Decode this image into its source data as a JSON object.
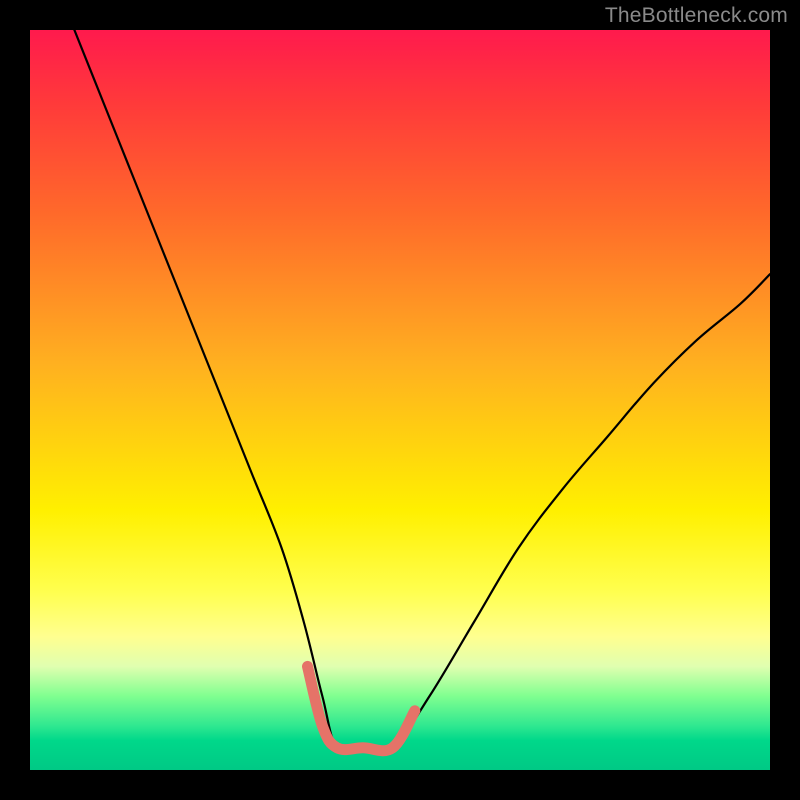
{
  "watermark": "TheBottleneck.com",
  "chart_data": {
    "type": "line",
    "title": "",
    "xlabel": "",
    "ylabel": "",
    "xlim": [
      0,
      100
    ],
    "ylim": [
      0,
      100
    ],
    "grid": false,
    "legend": false,
    "description": "V-shaped bottleneck curve on rainbow gradient; single black line with pink/coral highlight at trough",
    "series": [
      {
        "name": "curve",
        "color": "#000000",
        "x": [
          6,
          10,
          14,
          18,
          22,
          26,
          30,
          34,
          37,
          39.5,
          41.5,
          45,
          49,
          54,
          60,
          66,
          72,
          78,
          84,
          90,
          96,
          100
        ],
        "y": [
          100,
          90,
          80,
          70,
          60,
          50,
          40,
          30,
          20,
          10,
          3,
          3,
          3,
          10,
          20,
          30,
          38,
          45,
          52,
          58,
          63,
          67
        ]
      },
      {
        "name": "highlight",
        "color": "#e57368",
        "x": [
          37.5,
          39.5,
          41.5,
          45,
          49,
          52
        ],
        "y": [
          14,
          6,
          3,
          3,
          3,
          8
        ]
      }
    ]
  }
}
